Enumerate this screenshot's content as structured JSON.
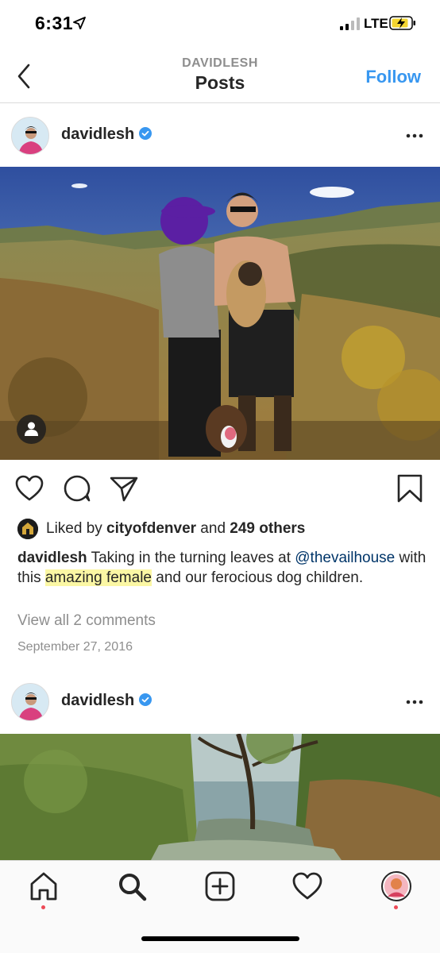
{
  "status_bar": {
    "time": "6:31",
    "network": "LTE"
  },
  "nav": {
    "subtitle": "DAVIDLESH",
    "title": "Posts",
    "follow_label": "Follow"
  },
  "posts": [
    {
      "username": "davidlesh",
      "liked_by_prefix": "Liked by ",
      "liked_by_user": "cityofdenver",
      "liked_by_and": " and ",
      "liked_by_others": "249 others",
      "caption_user": "davidlesh",
      "caption_text_1": " Taking in the turning leaves at ",
      "caption_mention": "@thevailhouse",
      "caption_text_2": " with this ",
      "caption_highlight": "amazing female",
      "caption_text_3": " and our ferocious dog children.",
      "view_comments": "View all 2 comments",
      "date": "September 27, 2016"
    },
    {
      "username": "davidlesh"
    }
  ],
  "colors": {
    "accent": "#3897f0",
    "text": "#262626",
    "muted": "#8e8e8e",
    "highlight": "#fbf7a4",
    "notification_dot": "#ed4956"
  },
  "icons": {
    "tab_home": "home-icon",
    "tab_search": "search-icon",
    "tab_add": "add-post-icon",
    "tab_activity": "heart-icon",
    "tab_profile": "profile-avatar-icon"
  }
}
